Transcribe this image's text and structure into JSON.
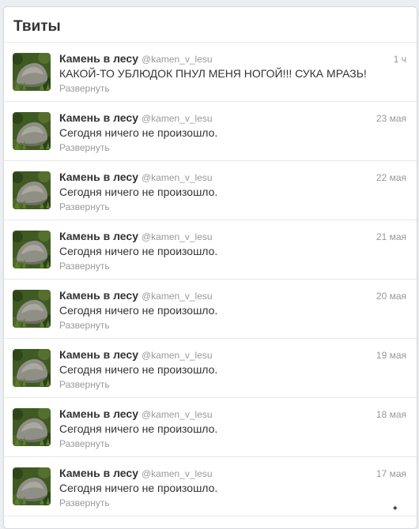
{
  "stream": {
    "title": "Твиты"
  },
  "tweets": [
    {
      "name": "Камень в лесу",
      "handle": "@kamen_v_lesu",
      "time": "1 ч",
      "text": "КАКОЙ-ТО УБЛЮДОК ПНУЛ МЕНЯ НОГОЙ!!! СУКА МРАЗЬ!",
      "expand": "Развернуть"
    },
    {
      "name": "Камень в лесу",
      "handle": "@kamen_v_lesu",
      "time": "23 мая",
      "text": "Сегодня ничего не произошло.",
      "expand": "Развернуть"
    },
    {
      "name": "Камень в лесу",
      "handle": "@kamen_v_lesu",
      "time": "22 мая",
      "text": "Сегодня ничего не произошло.",
      "expand": "Развернуть"
    },
    {
      "name": "Камень в лесу",
      "handle": "@kamen_v_lesu",
      "time": "21 мая",
      "text": "Сегодня ничего не произошло.",
      "expand": "Развернуть"
    },
    {
      "name": "Камень в лесу",
      "handle": "@kamen_v_lesu",
      "time": "20 мая",
      "text": "Сегодня ничего не произошло.",
      "expand": "Развернуть"
    },
    {
      "name": "Камень в лесу",
      "handle": "@kamen_v_lesu",
      "time": "19 мая",
      "text": "Сегодня ничего не произошло.",
      "expand": "Развернуть"
    },
    {
      "name": "Камень в лесу",
      "handle": "@kamen_v_lesu",
      "time": "18 мая",
      "text": "Сегодня ничего не произошло.",
      "expand": "Развернуть"
    },
    {
      "name": "Камень в лесу",
      "handle": "@kamen_v_lesu",
      "time": "17 мая",
      "text": "Сегодня ничего не произошло.",
      "expand": "Развернуть"
    }
  ],
  "avatar": {
    "icon": "stone-in-grass-avatar",
    "grass_color": "#3f5a22",
    "stone_color": "#8f8f86"
  },
  "colors": {
    "name": "#333333",
    "meta": "#999999",
    "border": "#e8e8e8"
  }
}
